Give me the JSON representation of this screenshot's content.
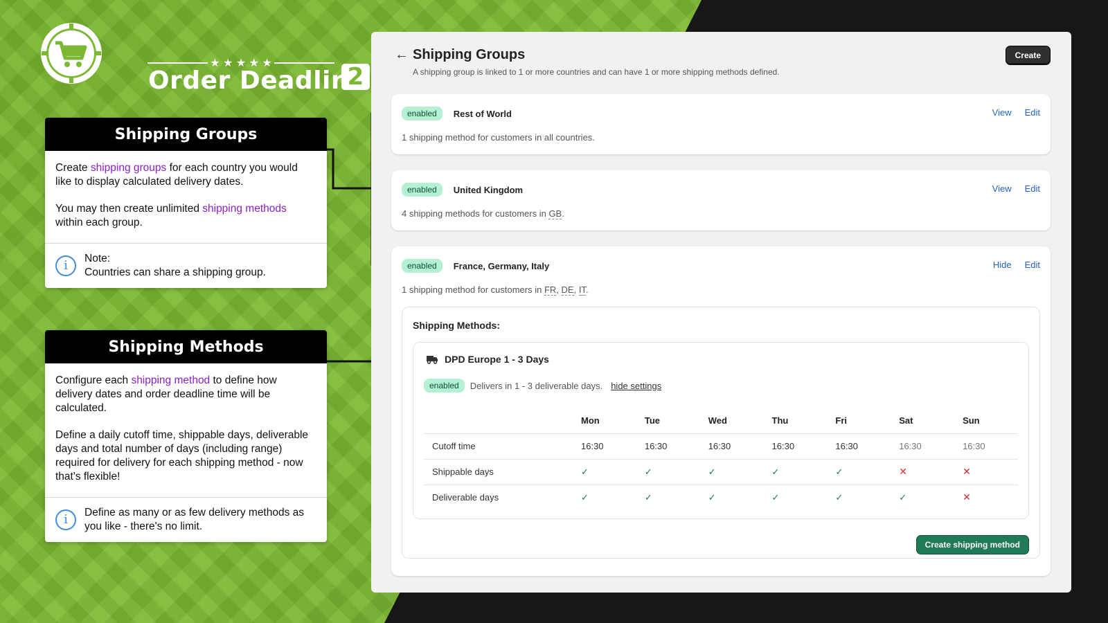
{
  "brand": {
    "title": "Order Deadline",
    "version": "2",
    "stars": "★ ★ ★ ★ ★"
  },
  "info_groups": {
    "title": "Shipping Groups",
    "p1_pre": "Create ",
    "p1_hl": "shipping groups",
    "p1_post": " for each country you would like to display calculated delivery dates.",
    "p2_pre": "You may then create unlimited ",
    "p2_hl": "shipping methods",
    "p2_post": " within each group.",
    "note_label": "Note:",
    "note_text": "Countries can share a shipping group.",
    "note_icon": "i"
  },
  "info_methods": {
    "title": "Shipping Methods",
    "p1_pre": "Configure each ",
    "p1_hl": "shipping method",
    "p1_post": " to define how delivery dates and order deadline time will be calculated.",
    "p2": "Define a daily cutoff time, shippable days, deliverable days and total number of days (including range) required for delivery for each shipping method - now that's flexible!",
    "note_text": "Define as many or as few delivery methods as you like - there's no limit.",
    "note_icon": "i"
  },
  "panel": {
    "back": "←",
    "title": "Shipping Groups",
    "subtitle": "A shipping group is linked to 1 or more countries and can have 1 or more shipping methods defined.",
    "create_label": "Create"
  },
  "groups": [
    {
      "status": "enabled",
      "name": "Rest of World",
      "action1": "View",
      "action2": "Edit",
      "desc": "1 shipping method for customers in all countries."
    },
    {
      "status": "enabled",
      "name": "United Kingdom",
      "action1": "View",
      "action2": "Edit",
      "desc_pre": "4 shipping methods for customers in ",
      "countries": [
        "GB"
      ],
      "desc_post": "."
    },
    {
      "status": "enabled",
      "name": "France, Germany, Italy",
      "action1": "Hide",
      "action2": "Edit",
      "desc_pre": "1 shipping method for customers in ",
      "countries": [
        "FR",
        "DE",
        "IT"
      ],
      "sep": ", ",
      "desc_post": "."
    }
  ],
  "methods": {
    "title": "Shipping Methods:",
    "method": {
      "icon": "truck-icon",
      "name": "DPD Europe 1 - 3 Days",
      "status": "enabled",
      "summary": "Delivers in 1 - 3 deliverable days.",
      "toggle_link": "hide settings"
    },
    "days": [
      "Mon",
      "Tue",
      "Wed",
      "Thu",
      "Fri",
      "Sat",
      "Sun"
    ],
    "rows": {
      "cutoff_label": "Cutoff time",
      "cutoff": [
        "16:30",
        "16:30",
        "16:30",
        "16:30",
        "16:30",
        "16:30",
        "16:30"
      ],
      "shippable_label": "Shippable days",
      "shippable": [
        true,
        true,
        true,
        true,
        true,
        false,
        false
      ],
      "deliverable_label": "Deliverable days",
      "deliverable": [
        true,
        true,
        true,
        true,
        true,
        true,
        false
      ]
    },
    "check_glyph": "✓",
    "cross_glyph": "✕",
    "create_label": "Create shipping method"
  },
  "colors": {
    "accent_purple": "#8a1fc4",
    "link_blue": "#2463bc",
    "badge_green": "#b4f0d2",
    "primary_button": "#1f7a55",
    "connector_dot": "#f5c518"
  }
}
